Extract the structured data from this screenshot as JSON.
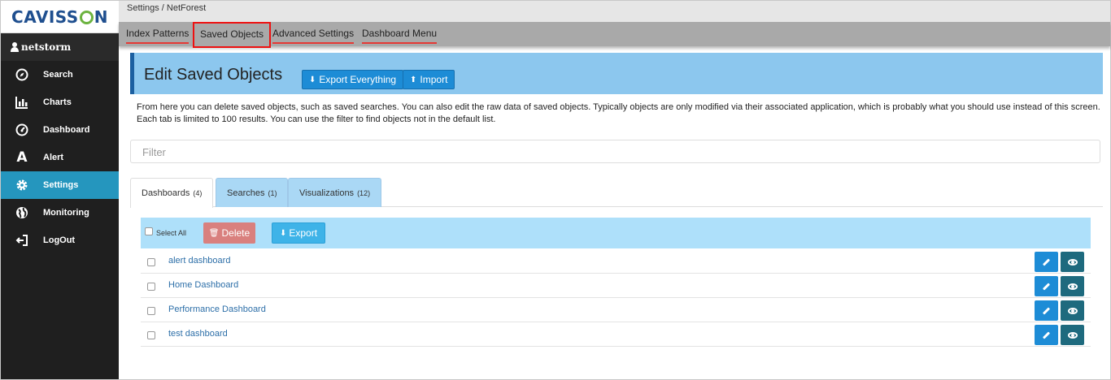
{
  "app": {
    "logo_text_1": "CAVISS",
    "logo_text_2": "N",
    "user": "netstorm"
  },
  "sidebar": {
    "items": [
      {
        "label": "Search",
        "icon": "compass-icon"
      },
      {
        "label": "Charts",
        "icon": "bar-chart-icon"
      },
      {
        "label": "Dashboard",
        "icon": "dashboard-icon"
      },
      {
        "label": "Alert",
        "icon": "alert-a-icon"
      },
      {
        "label": "Settings",
        "icon": "gear-icon",
        "active": true
      },
      {
        "label": "Monitoring",
        "icon": "globe-icon"
      },
      {
        "label": "LogOut",
        "icon": "logout-icon"
      }
    ]
  },
  "breadcrumb": "Settings / NetForest",
  "top_tabs": [
    "Index Patterns",
    "Saved Objects",
    "Advanced Settings",
    "Dashboard Menu"
  ],
  "header": {
    "title": "Edit Saved Objects",
    "export_everything": "Export Everything",
    "import": "Import"
  },
  "description": "From here you can delete saved objects, such as saved searches. You can also edit the raw data of saved objects. Typically objects are only modified via their associated application, which is probably what you should use instead of this screen. Each tab is limited to 100 results. You can use the filter to find objects not in the default list.",
  "filter": {
    "placeholder": "Filter"
  },
  "object_tabs": [
    {
      "label": "Dashboards",
      "count": "(4)"
    },
    {
      "label": "Searches",
      "count": "(1)"
    },
    {
      "label": "Visualizations",
      "count": "(12)"
    }
  ],
  "table": {
    "select_all": "Select All",
    "delete": "Delete",
    "export": "Export",
    "rows": [
      "alert dashboard",
      "Home Dashboard",
      "Performance Dashboard",
      "test dashboard"
    ]
  },
  "colors": {
    "accent": "#1d8cd6",
    "sidebar": "#1f1f1f",
    "active_nav": "#2596be",
    "highlight": "#e11111"
  }
}
